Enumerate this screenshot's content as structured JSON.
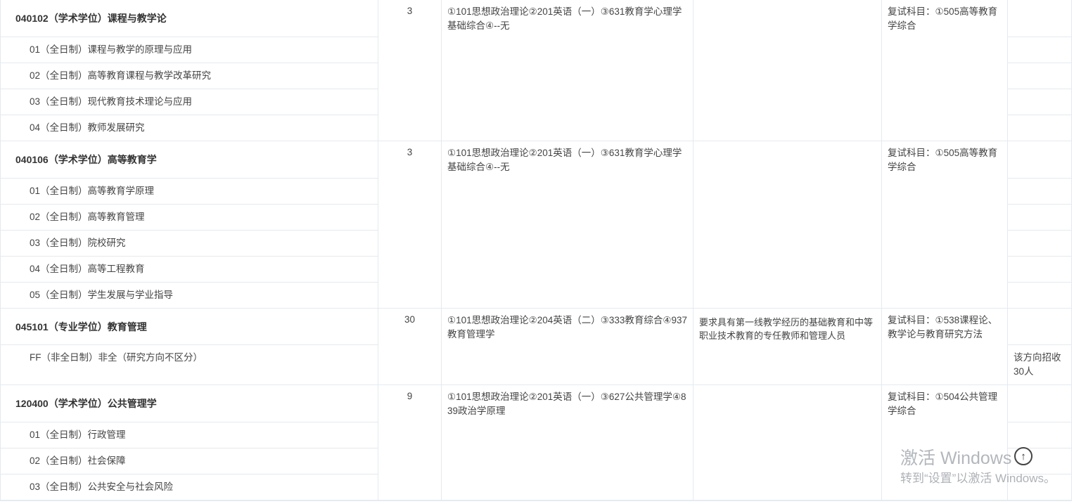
{
  "groups": [
    {
      "major": "040102（学术学位）课程与教学论",
      "count": "3",
      "exam": "①101思想政治理论②201英语（一）③631教育学心理学基础综合④--无",
      "requirement": "",
      "retest": "复试科目：①505高等教育学综合",
      "note": "",
      "directions": [
        "01（全日制）课程与教学的原理与应用",
        "02（全日制）高等教育课程与教学改革研究",
        "03（全日制）现代教育技术理论与应用",
        "04（全日制）教师发展研究"
      ]
    },
    {
      "major": "040106（学术学位）高等教育学",
      "count": "3",
      "exam": "①101思想政治理论②201英语（一）③631教育学心理学基础综合④--无",
      "requirement": "",
      "retest": "复试科目：①505高等教育学综合",
      "note": "",
      "directions": [
        "01（全日制）高等教育学原理",
        "02（全日制）高等教育管理",
        "03（全日制）院校研究",
        "04（全日制）高等工程教育",
        "05（全日制）学生发展与学业指导"
      ]
    },
    {
      "major": "045101（专业学位）教育管理",
      "count": "30",
      "exam": "①101思想政治理论②204英语（二）③333教育综合④937教育管理学",
      "requirement": "要求具有第一线教学经历的基础教育和中等职业技术教育的专任教师和管理人员",
      "retest": "复试科目：①538课程论、教学论与教育研究方法",
      "note": "该方向招收30人",
      "directions": [
        "FF（非全日制）非全（研究方向不区分）"
      ]
    },
    {
      "major": "120400（学术学位）公共管理学",
      "count": "9",
      "exam": "①101思想政治理论②201英语（一）③627公共管理学④839政治学原理",
      "requirement": "",
      "retest": "复试科目：①504公共管理学综合",
      "note": "",
      "directions": [
        "01（全日制）行政管理",
        "02（全日制）社会保障",
        "03（全日制）公共安全与社会风险"
      ]
    }
  ],
  "watermark": {
    "title": "激活 Windows",
    "subtitle": "转到“设置”以激活 Windows。"
  },
  "scroll_top_icon": "arrow-up-circle-icon"
}
